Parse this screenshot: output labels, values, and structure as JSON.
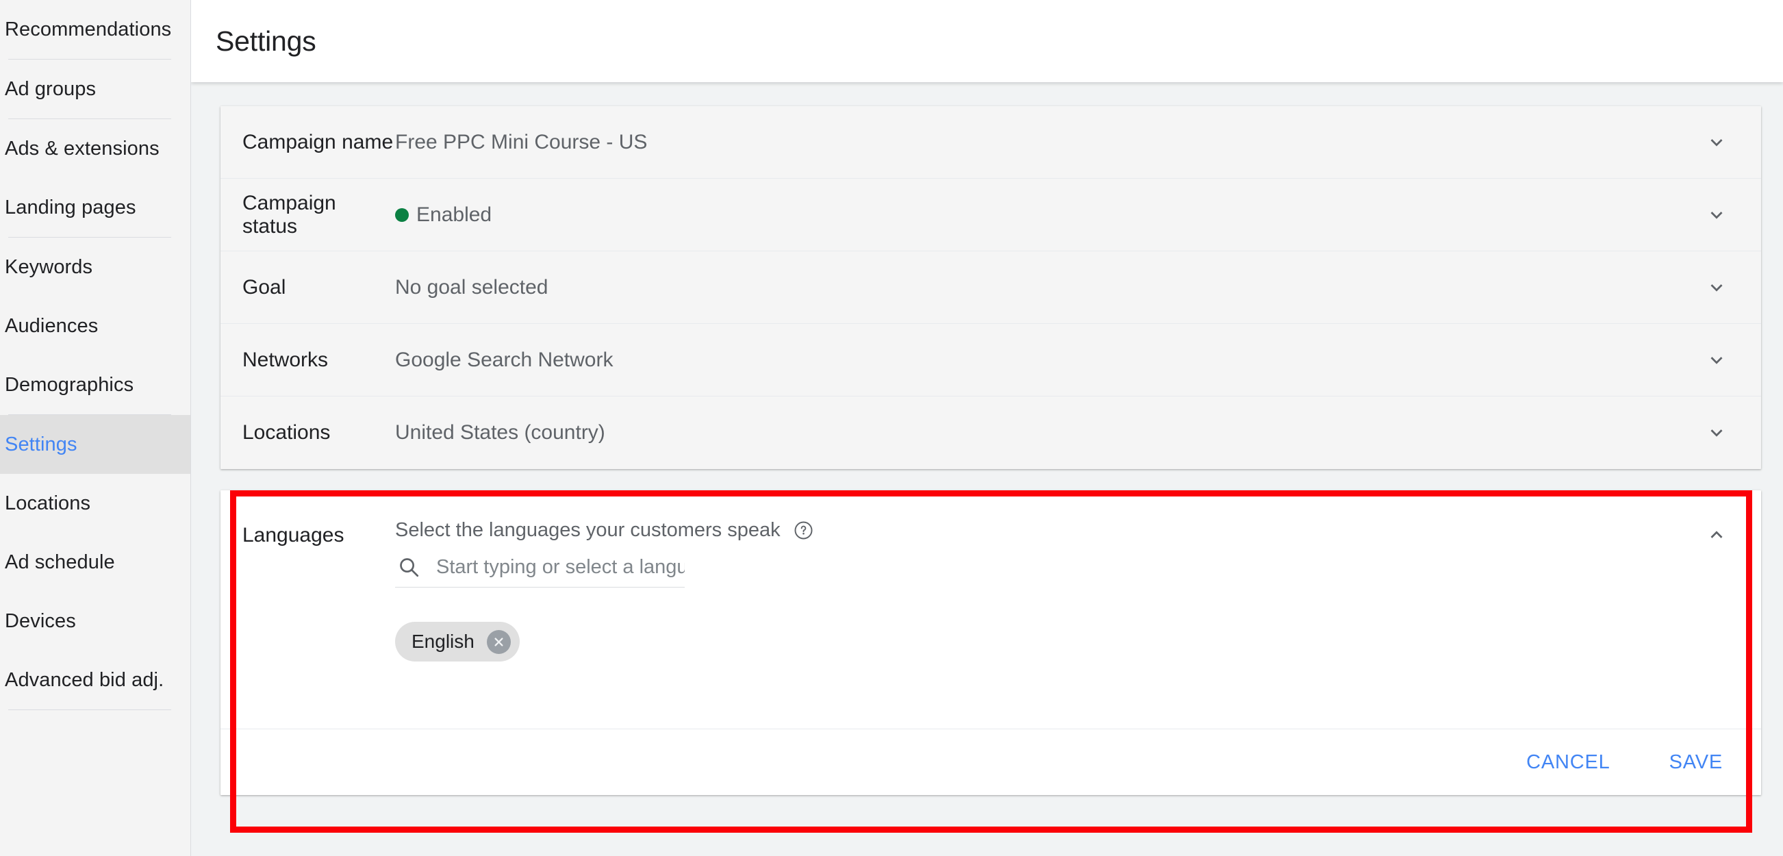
{
  "sidebar": {
    "items": [
      {
        "label": "Recommendations",
        "active": false,
        "sep_after": true
      },
      {
        "label": "Ad groups",
        "active": false,
        "sep_after": true
      },
      {
        "label": "Ads & extensions",
        "active": false,
        "sep_after": false
      },
      {
        "label": "Landing pages",
        "active": false,
        "sep_after": true
      },
      {
        "label": "Keywords",
        "active": false,
        "sep_after": false
      },
      {
        "label": "Audiences",
        "active": false,
        "sep_after": false
      },
      {
        "label": "Demographics",
        "active": false,
        "sep_after": true
      },
      {
        "label": "Settings",
        "active": true,
        "sep_after": false
      },
      {
        "label": "Locations",
        "active": false,
        "sep_after": false
      },
      {
        "label": "Ad schedule",
        "active": false,
        "sep_after": false
      },
      {
        "label": "Devices",
        "active": false,
        "sep_after": false
      },
      {
        "label": "Advanced bid adj.",
        "active": false,
        "sep_after": true
      }
    ],
    "active_color": "#4285f4",
    "active_bg": "#e0e0e0"
  },
  "header": {
    "title": "Settings"
  },
  "settings_card": {
    "rows": [
      {
        "label": "Campaign name",
        "value": "Free PPC Mini Course - US",
        "has_dot": false,
        "chevron": "chevron-down"
      },
      {
        "label": "Campaign status",
        "value": "Enabled",
        "has_dot": true,
        "dot_color": "#0b8043",
        "chevron": "chevron-down"
      },
      {
        "label": "Goal",
        "value": "No goal selected",
        "has_dot": false,
        "chevron": "chevron-down"
      },
      {
        "label": "Networks",
        "value": "Google Search Network",
        "has_dot": false,
        "chevron": "chevron-down"
      },
      {
        "label": "Locations",
        "value": "United States (country)",
        "has_dot": false,
        "chevron": "chevron-down"
      }
    ]
  },
  "languages": {
    "label": "Languages",
    "description": "Select the languages your customers speak",
    "help_icon": "help-circle-icon",
    "search_placeholder": "Start typing or select a language",
    "search_value": "",
    "search_icon": "search-icon",
    "chips": [
      {
        "label": "English",
        "remove_icon": "close-circle-icon"
      }
    ],
    "chevron": "chevron-up",
    "cancel_label": "CANCEL",
    "save_label": "SAVE",
    "highlight_color": "#fb0007",
    "link_color": "#4285f4"
  }
}
